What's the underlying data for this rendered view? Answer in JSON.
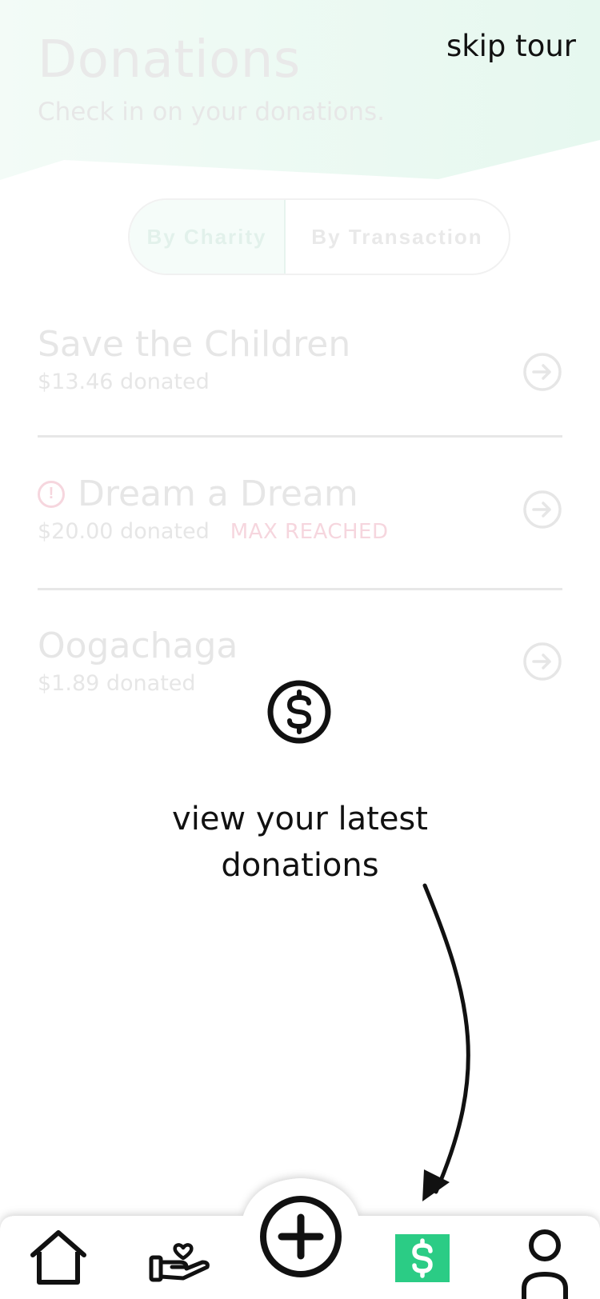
{
  "header": {
    "title": "Donations",
    "subtitle": "Check in on your donations.",
    "skip_label": "skip tour",
    "accent": "#e9f8f1"
  },
  "segment": {
    "tabs": [
      {
        "label": "By Charity",
        "active": true
      },
      {
        "label": "By Transaction",
        "active": false
      }
    ]
  },
  "charities": [
    {
      "name": "Save the Children",
      "amount": "$13.46 donated",
      "badge": "",
      "icon": "arrow-right-circle-icon"
    },
    {
      "name": "Dream a Dream",
      "amount": "$20.00 donated",
      "badge": "MAX REACHED",
      "icon": "arrow-right-circle-icon",
      "warning": "alert-circle-icon"
    },
    {
      "name": "Oogachaga",
      "amount": "$1.89 donated",
      "badge": "",
      "icon": "arrow-right-circle-icon"
    }
  ],
  "tour": {
    "icon": "dollar-circle-icon",
    "message": "view your latest donations"
  },
  "tabbar": {
    "items": [
      {
        "name": "home",
        "icon": "home-icon"
      },
      {
        "name": "charity",
        "icon": "hand-heart-icon"
      },
      {
        "name": "add",
        "icon": "plus-circle-icon"
      },
      {
        "name": "donations",
        "icon": "dollar-square-icon",
        "active": true,
        "color": "#2bcc85"
      },
      {
        "name": "profile",
        "icon": "user-icon"
      }
    ]
  }
}
